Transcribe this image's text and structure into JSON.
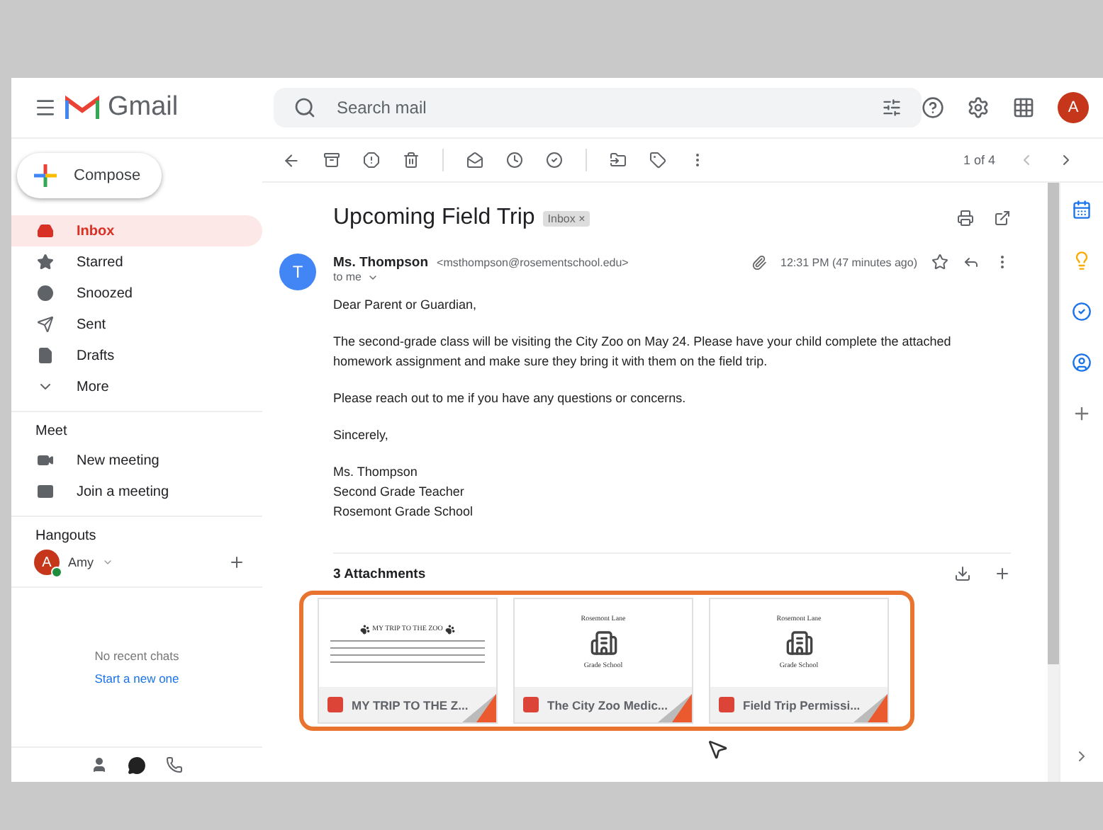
{
  "header": {
    "app_name": "Gmail",
    "search": {
      "placeholder": "Search mail"
    },
    "avatar": "A"
  },
  "sidebar": {
    "compose": "Compose",
    "items": [
      {
        "label": "Inbox",
        "selected": true
      },
      {
        "label": "Starred",
        "selected": false
      },
      {
        "label": "Snoozed",
        "selected": false
      },
      {
        "label": "Sent",
        "selected": false
      },
      {
        "label": "Drafts",
        "selected": false
      },
      {
        "label": "More",
        "selected": false
      }
    ],
    "meet": {
      "title": "Meet",
      "items": [
        {
          "label": "New meeting"
        },
        {
          "label": "Join a meeting"
        }
      ]
    },
    "hangouts": {
      "title": "Hangouts",
      "user": {
        "initial": "A",
        "name": "Amy",
        "online": true
      },
      "empty": "No recent chats",
      "link": "Start a new one"
    }
  },
  "toolbar": {
    "pager": "1 of 4"
  },
  "message": {
    "subject": "Upcoming Field Trip",
    "label": "Inbox",
    "label_close": "×",
    "avatar": "T",
    "sender": "Ms. Thompson",
    "email": "<msthompson@rosementschool.edu>",
    "time": "12:31 PM (47 minutes ago)",
    "to": "to me",
    "body": [
      "Dear Parent or Guardian,",
      "The second-grade class will be visiting the City Zoo on May 24. Please have your child complete the attached homework assignment and make sure they bring it with them on the field trip.",
      "Please reach out to me if you have any questions or concerns.",
      "Sincerely,"
    ],
    "signature": [
      "Ms. Thompson",
      "Second Grade Teacher",
      "Rosemont Grade School"
    ]
  },
  "attachments": {
    "title": "3 Attachments",
    "highlighted": true,
    "files": [
      {
        "kind": "worksheet",
        "name": "MY TRIP TO THE Z...",
        "preview_title": "MY TRIP TO THE ZOO"
      },
      {
        "kind": "letter",
        "name": "The City Zoo Medic...",
        "preview_top": "Rosemont Lane",
        "preview_bottom": "Grade School"
      },
      {
        "kind": "letter",
        "name": "Field Trip Permissi...",
        "preview_top": "Rosemont Lane",
        "preview_bottom": "Grade School"
      }
    ]
  }
}
